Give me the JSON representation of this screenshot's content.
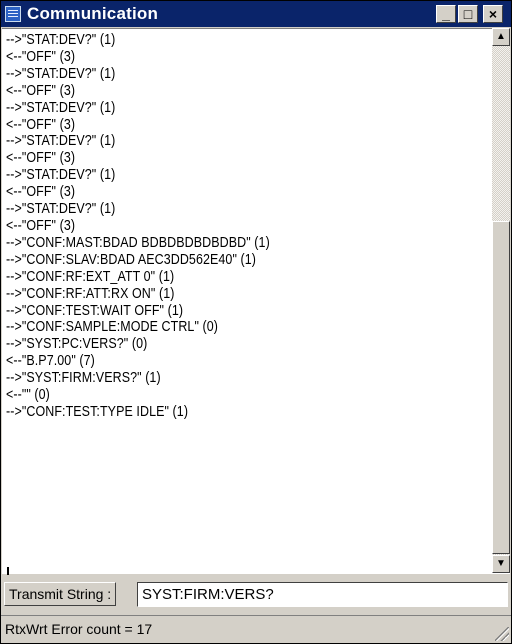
{
  "window": {
    "title": "Communication",
    "icon": "app-icon",
    "buttons": {
      "minimize": "_",
      "maximize": "□",
      "close": "×"
    }
  },
  "log": {
    "lines": [
      "-->\"STAT:DEV?\" (1)",
      "<--\"OFF\" (3)",
      "-->\"STAT:DEV?\" (1)",
      "<--\"OFF\" (3)",
      "-->\"STAT:DEV?\" (1)",
      "<--\"OFF\" (3)",
      "-->\"STAT:DEV?\" (1)",
      "<--\"OFF\" (3)",
      "-->\"STAT:DEV?\" (1)",
      "<--\"OFF\" (3)",
      "-->\"STAT:DEV?\" (1)",
      "<--\"OFF\" (3)",
      "-->\"CONF:MAST:BDAD BDBDBDBDBDBD\" (1)",
      "-->\"CONF:SLAV:BDAD AEC3DD562E40\" (1)",
      "-->\"CONF:RF:EXT_ATT 0\" (1)",
      "-->\"CONF:RF:ATT:RX ON\" (1)",
      "-->\"CONF:TEST:WAIT OFF\" (1)",
      "-->\"CONF:SAMPLE:MODE CTRL\" (0)",
      "-->\"SYST:PC:VERS?\" (0)",
      "<--\"B.P7.00\" (7)",
      "-->\"SYST:FIRM:VERS?\" (1)",
      "<--\"\" (0)",
      "-->\"CONF:TEST:TYPE IDLE\" (1)"
    ]
  },
  "scrollbar": {
    "up_arrow": "▲",
    "down_arrow": "▼"
  },
  "transmit": {
    "label": "Transmit String :",
    "value": "SYST:FIRM:VERS?"
  },
  "status": {
    "text": "RtxWrt Error count = 17"
  }
}
